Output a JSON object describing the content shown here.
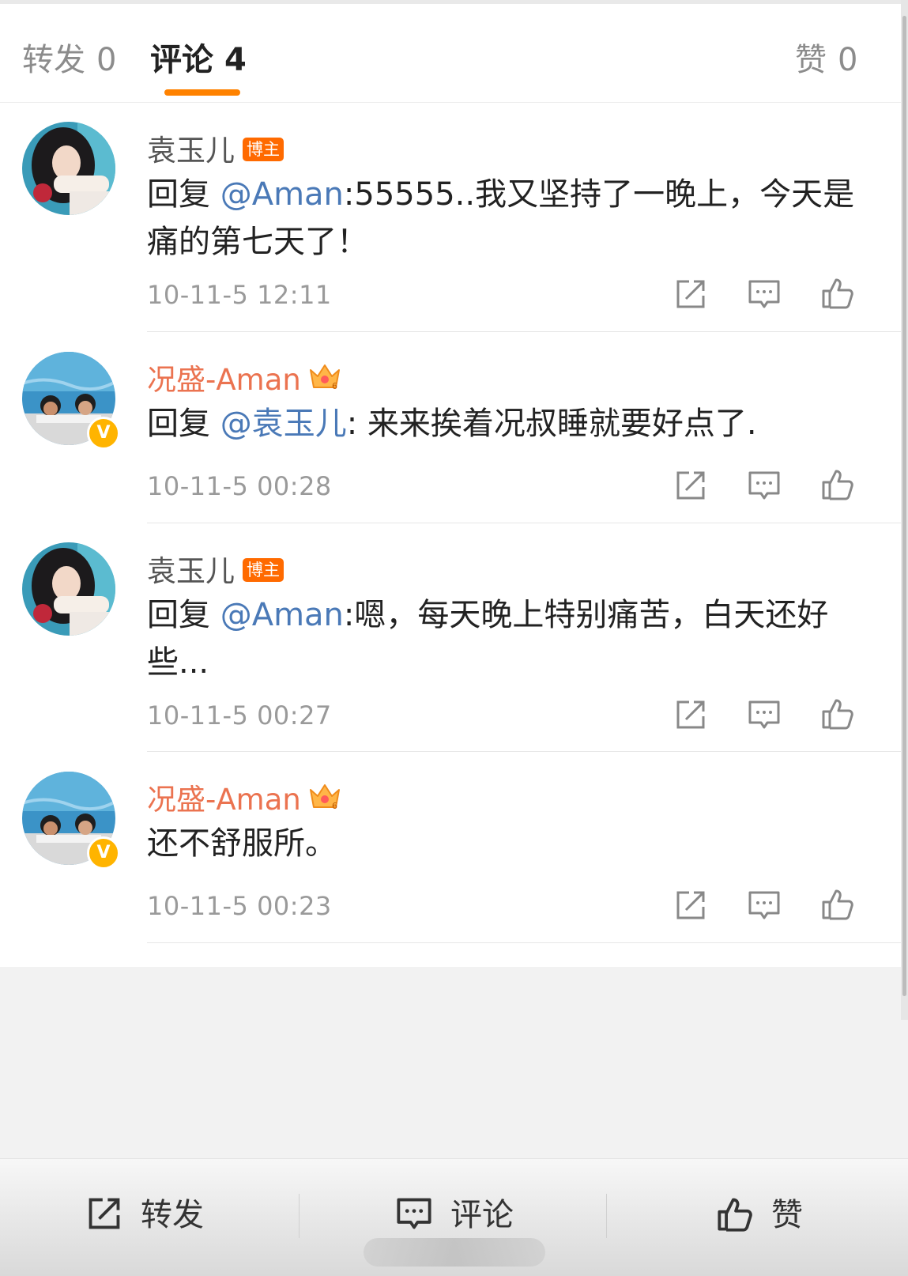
{
  "tabs": [
    {
      "label": "转发",
      "count": "0"
    },
    {
      "label": "评论",
      "count": "4"
    },
    {
      "label": "赞",
      "count": "0"
    }
  ],
  "comments": [
    {
      "author": "袁玉儿",
      "tag": "博主",
      "reply_prefix": "回复 ",
      "mention": "@Aman",
      "text": ":55555..我又坚持了一晚上，今天是痛的第七天了！",
      "time": "10-11-5 12:11"
    },
    {
      "author": "况盛-Aman",
      "crown_level": "6",
      "reply_prefix": "回复 ",
      "mention": "@袁玉儿",
      "text": ": 来来挨着况叔睡就要好点了.",
      "time": "10-11-5 00:28"
    },
    {
      "author": "袁玉儿",
      "tag": "博主",
      "reply_prefix": "回复 ",
      "mention": "@Aman",
      "text": ":嗯，每天晚上特别痛苦，白天还好些...",
      "time": "10-11-5 00:27"
    },
    {
      "author": "况盛-Aman",
      "crown_level": "6",
      "text": "还不舒服所。",
      "time": "10-11-5 00:23"
    }
  ],
  "bottom_bar": {
    "repost": "转发",
    "comment": "评论",
    "like": "赞"
  },
  "colors": {
    "accent": "#ff8200",
    "vip_name": "#eb7350",
    "mention": "#4a79b7",
    "host_tag": "#ff6a00",
    "verified_badge": "#ffb400"
  }
}
